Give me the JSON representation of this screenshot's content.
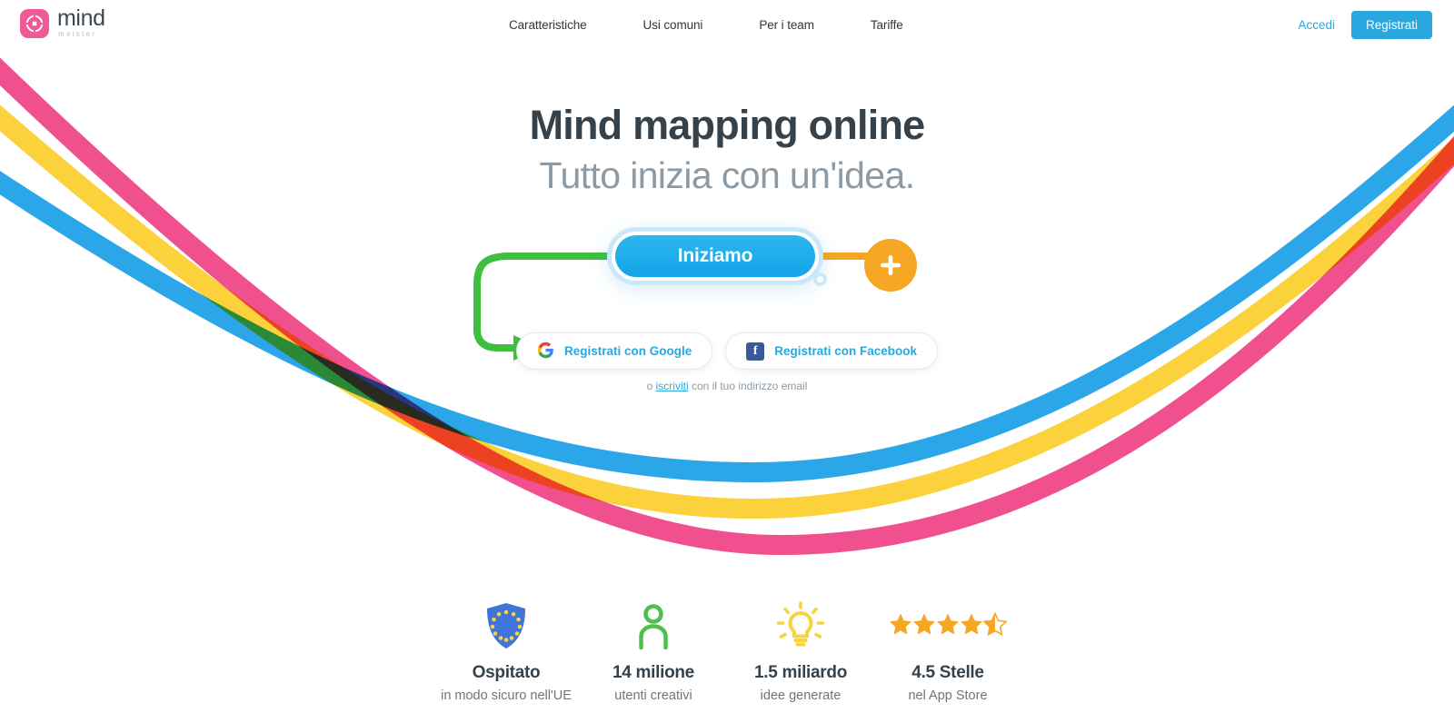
{
  "brand": {
    "name": "mind",
    "suffix": "meister",
    "mark_color": "#ED5A96",
    "icon": "mindmeister-logo-icon"
  },
  "header": {
    "nav": [
      {
        "label": "Caratteristiche"
      },
      {
        "label": "Usi comuni"
      },
      {
        "label": "Per i team"
      },
      {
        "label": "Tariffe"
      }
    ],
    "login_label": "Accedi",
    "signup_label": "Registrati",
    "accent_color": "#29a8e0"
  },
  "hero": {
    "title": "Mind mapping online",
    "subtitle": "Tutto inizia con un'idea.",
    "cta_label": "Iniziamo",
    "cta_color": "#13a4e8",
    "plus_icon": "plus-icon",
    "plus_color": "#F5A623",
    "connector_green": "#3FBF3F",
    "connector_orange": "#F5A623"
  },
  "social": {
    "google": {
      "label": "Registrati con Google",
      "icon": "google-icon"
    },
    "facebook": {
      "label": "Registrati con Facebook",
      "icon": "facebook-icon",
      "glyph": "f",
      "color": "#3b5998"
    }
  },
  "email_signup": {
    "prefix": "o ",
    "link": "iscriviti",
    "suffix": " con il tuo indirizzo email"
  },
  "stats": [
    {
      "icon": "eu-shield-icon",
      "icon_color": "#3F74DB",
      "value": "Ospitato",
      "label": "in modo sicuro nell'UE"
    },
    {
      "icon": "person-icon",
      "icon_color": "#4CC04C",
      "value": "14 milione",
      "label": "utenti creativi"
    },
    {
      "icon": "lightbulb-icon",
      "icon_color": "#F7D340",
      "value": "1.5 miliardo",
      "label": "idee generate"
    },
    {
      "icon": "star-rating-icon",
      "icon_color": "#F5A623",
      "value": "4.5 Stelle",
      "label": "nel App Store",
      "stars_full": 4,
      "stars_half": 1
    }
  ],
  "background": {
    "curve_pink": "#F0508E",
    "curve_yellow": "#FBD13C",
    "curve_blue": "#2BA6E8"
  }
}
